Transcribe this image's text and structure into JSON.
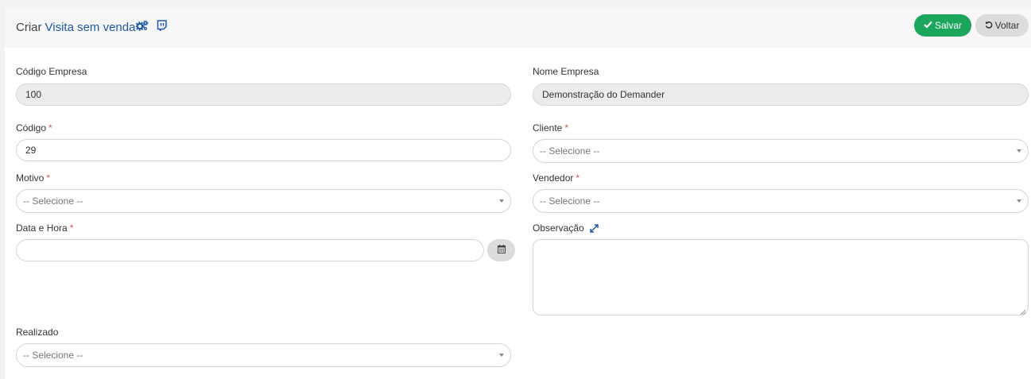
{
  "header": {
    "title_prefix": "Criar",
    "title_link": "Visita sem venda",
    "save_label": "Salvar",
    "back_label": "Voltar"
  },
  "form": {
    "codigo_empresa": {
      "label": "Código Empresa",
      "value": "100"
    },
    "nome_empresa": {
      "label": "Nome Empresa",
      "value": "Demonstração do Demander"
    },
    "codigo": {
      "label": "Código",
      "required": "*",
      "value": "29"
    },
    "cliente": {
      "label": "Cliente",
      "required": "*",
      "value": "-- Selecione --"
    },
    "motivo": {
      "label": "Motivo",
      "required": "*",
      "value": "-- Selecione --"
    },
    "vendedor": {
      "label": "Vendedor",
      "required": "*",
      "value": "-- Selecione --"
    },
    "data_hora": {
      "label": "Data e Hora",
      "required": "*",
      "value": ""
    },
    "observacao": {
      "label": "Observação",
      "value": ""
    },
    "realizado": {
      "label": "Realizado",
      "value": "-- Selecione --"
    }
  },
  "icons": {
    "title_icon": "cogs-icon",
    "title_icon2": "twitch-icon",
    "save_icon": "check-icon",
    "back_icon": "undo-icon",
    "calendar_icon": "calendar-icon",
    "expand_icon": "expand-icon"
  },
  "colors": {
    "accent": "#1f58a8",
    "save": "#1ba65b",
    "required": "#d9534f"
  }
}
